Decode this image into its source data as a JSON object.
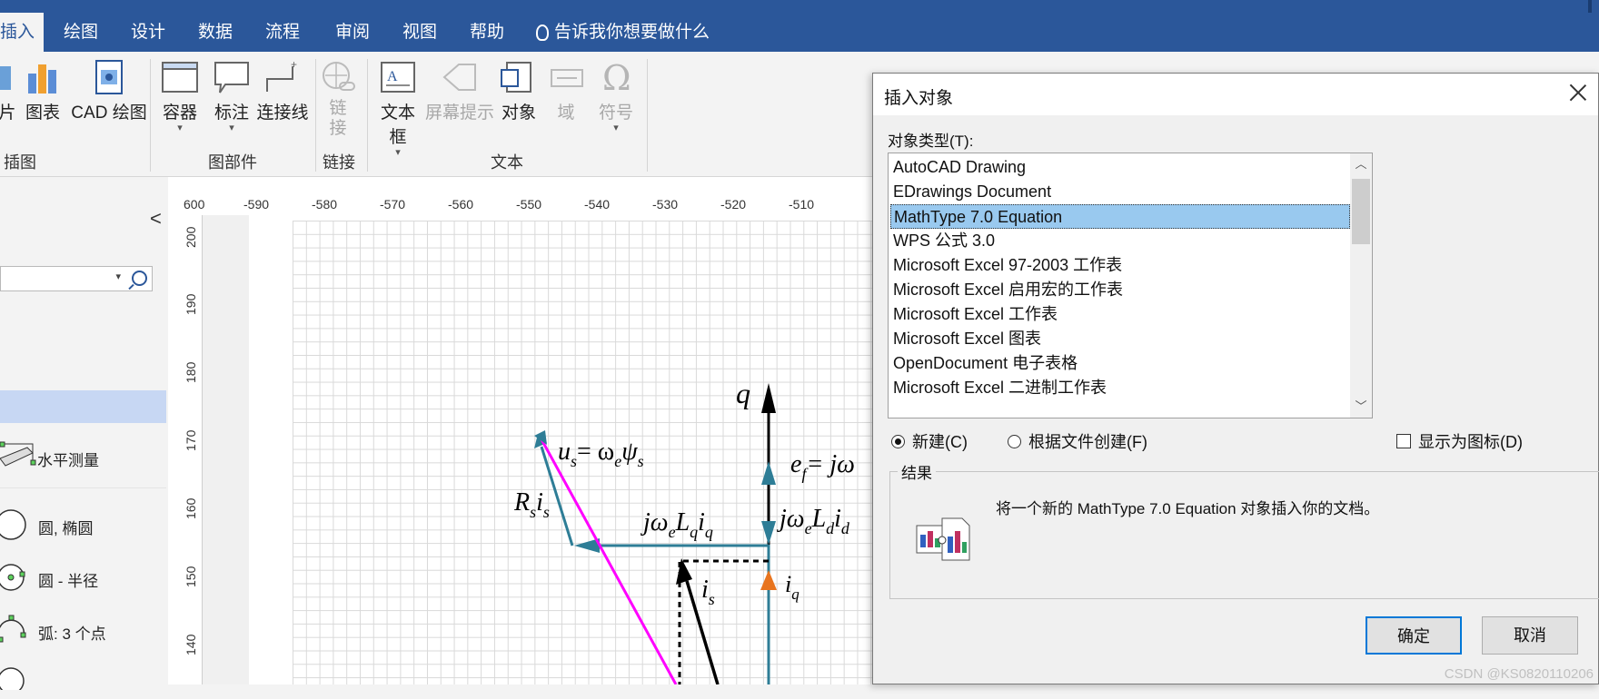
{
  "ribbon_tabs": {
    "active": "插入",
    "items": [
      "绘图",
      "设计",
      "数据",
      "流程",
      "审阅",
      "视图",
      "帮助"
    ],
    "tell_me": "告诉我你想要做什么"
  },
  "ribbon": {
    "picture_partial": "片",
    "chart": "图表",
    "cad": "CAD 绘图",
    "group_illustrations": "插图",
    "container": "容器",
    "callout": "标注",
    "connector": "连接线",
    "group_diagram_parts": "图部件",
    "link": "链\n接",
    "group_links": "链接",
    "textbox": "文本框",
    "screentip": "屏幕提示",
    "object": "对象",
    "field": "域",
    "symbol": "符号",
    "group_text": "文本"
  },
  "left_pane": {
    "collapse": "<",
    "shapes": [
      "水平测量",
      "圆, 椭圆",
      "圆 - 半径",
      "弧: 3 个点"
    ]
  },
  "ruler": {
    "h_ticks": [
      "600",
      "-590",
      "-580",
      "-570",
      "-560",
      "-550",
      "-540",
      "-530",
      "-520",
      "-510"
    ],
    "v_ticks": [
      "200",
      "190",
      "180",
      "170",
      "160",
      "150",
      "140"
    ]
  },
  "diagram_labels": {
    "q": "q",
    "us": "u",
    "us_sub": "s",
    "us_eq": "= ω",
    "us_e": "e",
    "us_psi": "ψ",
    "us_psi_sub": "s",
    "rs": "R",
    "rs_sub": "s",
    "rs_i": "i",
    "rs_i_sub": "s",
    "jwlq": "jω",
    "jwlq_e": "e",
    "jwlq_L": "L",
    "jwlq_Lsub": "q",
    "jwlq_i": "i",
    "jwlq_isub": "q",
    "jwld": "jω",
    "jwld_e": "e",
    "jwld_L": "L",
    "jwld_Lsub": "d",
    "jwld_i": "i",
    "jwld_isub": "d",
    "ef": "e",
    "ef_sub": "f",
    "ef_rest": "= jω",
    "is": "i",
    "is_sub": "s",
    "iq": "i",
    "iq_sub": "q"
  },
  "dialog": {
    "title": "插入对象",
    "object_type_label": "对象类型(T):",
    "object_types": [
      "AutoCAD Drawing",
      "EDrawings Document",
      "MathType 7.0 Equation",
      "WPS 公式 3.0",
      "Microsoft Excel 97-2003 工作表",
      "Microsoft Excel 启用宏的工作表",
      "Microsoft Excel 工作表",
      "Microsoft Excel 图表",
      "OpenDocument 电子表格",
      "Microsoft Excel 二进制工作表"
    ],
    "selected_index": 2,
    "radio_new": "新建(C)",
    "radio_from_file": "根据文件创建(F)",
    "display_as_icon": "显示为图标(D)",
    "result_label": "结果",
    "result_text": "将一个新的 MathType 7.0 Equation 对象插入你的文档。",
    "ok": "确定",
    "cancel": "取消"
  },
  "watermark": "CSDN @KS0820110206",
  "colors": {
    "ribbon_blue": "#2b579a",
    "teal_vector": "#2e7d96",
    "magenta_vector": "#ff00ff",
    "orange_arrow": "#e8741e",
    "selection": "#99c9ef"
  }
}
